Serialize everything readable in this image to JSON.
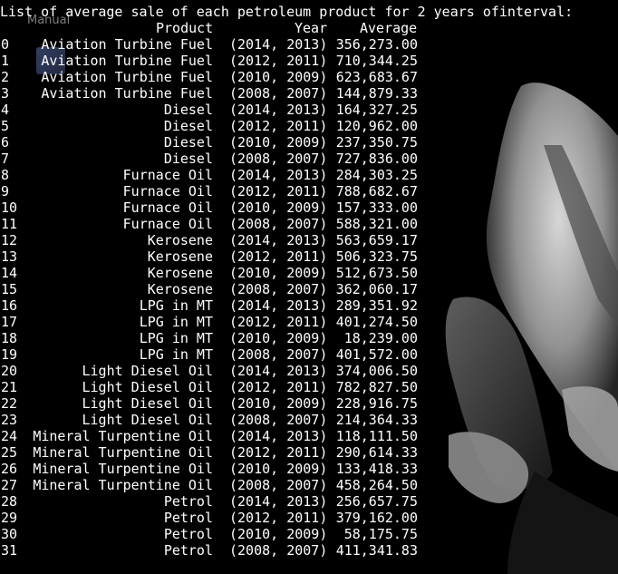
{
  "desktop": {
    "icon_label": "Manual"
  },
  "terminal": {
    "heading": "List of average sale of each petroleum product for 2 years ofinterval:",
    "columns": {
      "product": "Product",
      "year": "Year",
      "average": "Average"
    },
    "rows": [
      {
        "index": "0",
        "product": "Aviation Turbine Fuel",
        "year": "(2014, 2013)",
        "average": "356,273.00"
      },
      {
        "index": "1",
        "product": "Aviation Turbine Fuel",
        "year": "(2012, 2011)",
        "average": "710,344.25"
      },
      {
        "index": "2",
        "product": "Aviation Turbine Fuel",
        "year": "(2010, 2009)",
        "average": "623,683.67"
      },
      {
        "index": "3",
        "product": "Aviation Turbine Fuel",
        "year": "(2008, 2007)",
        "average": "144,879.33"
      },
      {
        "index": "4",
        "product": "Diesel",
        "year": "(2014, 2013)",
        "average": "164,327.25"
      },
      {
        "index": "5",
        "product": "Diesel",
        "year": "(2012, 2011)",
        "average": "120,962.00"
      },
      {
        "index": "6",
        "product": "Diesel",
        "year": "(2010, 2009)",
        "average": "237,350.75"
      },
      {
        "index": "7",
        "product": "Diesel",
        "year": "(2008, 2007)",
        "average": "727,836.00"
      },
      {
        "index": "8",
        "product": "Furnace Oil",
        "year": "(2014, 2013)",
        "average": "284,303.25"
      },
      {
        "index": "9",
        "product": "Furnace Oil",
        "year": "(2012, 2011)",
        "average": "788,682.67"
      },
      {
        "index": "10",
        "product": "Furnace Oil",
        "year": "(2010, 2009)",
        "average": "157,333.00"
      },
      {
        "index": "11",
        "product": "Furnace Oil",
        "year": "(2008, 2007)",
        "average": "588,321.00"
      },
      {
        "index": "12",
        "product": "Kerosene",
        "year": "(2014, 2013)",
        "average": "563,659.17"
      },
      {
        "index": "13",
        "product": "Kerosene",
        "year": "(2012, 2011)",
        "average": "506,323.75"
      },
      {
        "index": "14",
        "product": "Kerosene",
        "year": "(2010, 2009)",
        "average": "512,673.50"
      },
      {
        "index": "15",
        "product": "Kerosene",
        "year": "(2008, 2007)",
        "average": "362,060.17"
      },
      {
        "index": "16",
        "product": "LPG in MT",
        "year": "(2014, 2013)",
        "average": "289,351.92"
      },
      {
        "index": "17",
        "product": "LPG in MT",
        "year": "(2012, 2011)",
        "average": "401,274.50"
      },
      {
        "index": "18",
        "product": "LPG in MT",
        "year": "(2010, 2009)",
        "average": "18,239.00"
      },
      {
        "index": "19",
        "product": "LPG in MT",
        "year": "(2008, 2007)",
        "average": "401,572.00"
      },
      {
        "index": "20",
        "product": "Light Diesel Oil",
        "year": "(2014, 2013)",
        "average": "374,006.50"
      },
      {
        "index": "21",
        "product": "Light Diesel Oil",
        "year": "(2012, 2011)",
        "average": "782,827.50"
      },
      {
        "index": "22",
        "product": "Light Diesel Oil",
        "year": "(2010, 2009)",
        "average": "228,916.75"
      },
      {
        "index": "23",
        "product": "Light Diesel Oil",
        "year": "(2008, 2007)",
        "average": "214,364.33"
      },
      {
        "index": "24",
        "product": "Mineral Turpentine Oil",
        "year": "(2014, 2013)",
        "average": "118,111.50"
      },
      {
        "index": "25",
        "product": "Mineral Turpentine Oil",
        "year": "(2012, 2011)",
        "average": "290,614.33"
      },
      {
        "index": "26",
        "product": "Mineral Turpentine Oil",
        "year": "(2010, 2009)",
        "average": "133,418.33"
      },
      {
        "index": "27",
        "product": "Mineral Turpentine Oil",
        "year": "(2008, 2007)",
        "average": "458,264.50"
      },
      {
        "index": "28",
        "product": "Petrol",
        "year": "(2014, 2013)",
        "average": "256,657.75"
      },
      {
        "index": "29",
        "product": "Petrol",
        "year": "(2012, 2011)",
        "average": "379,162.00"
      },
      {
        "index": "30",
        "product": "Petrol",
        "year": "(2010, 2009)",
        "average": "58,175.75"
      },
      {
        "index": "31",
        "product": "Petrol",
        "year": "(2008, 2007)",
        "average": "411,341.83"
      }
    ]
  }
}
